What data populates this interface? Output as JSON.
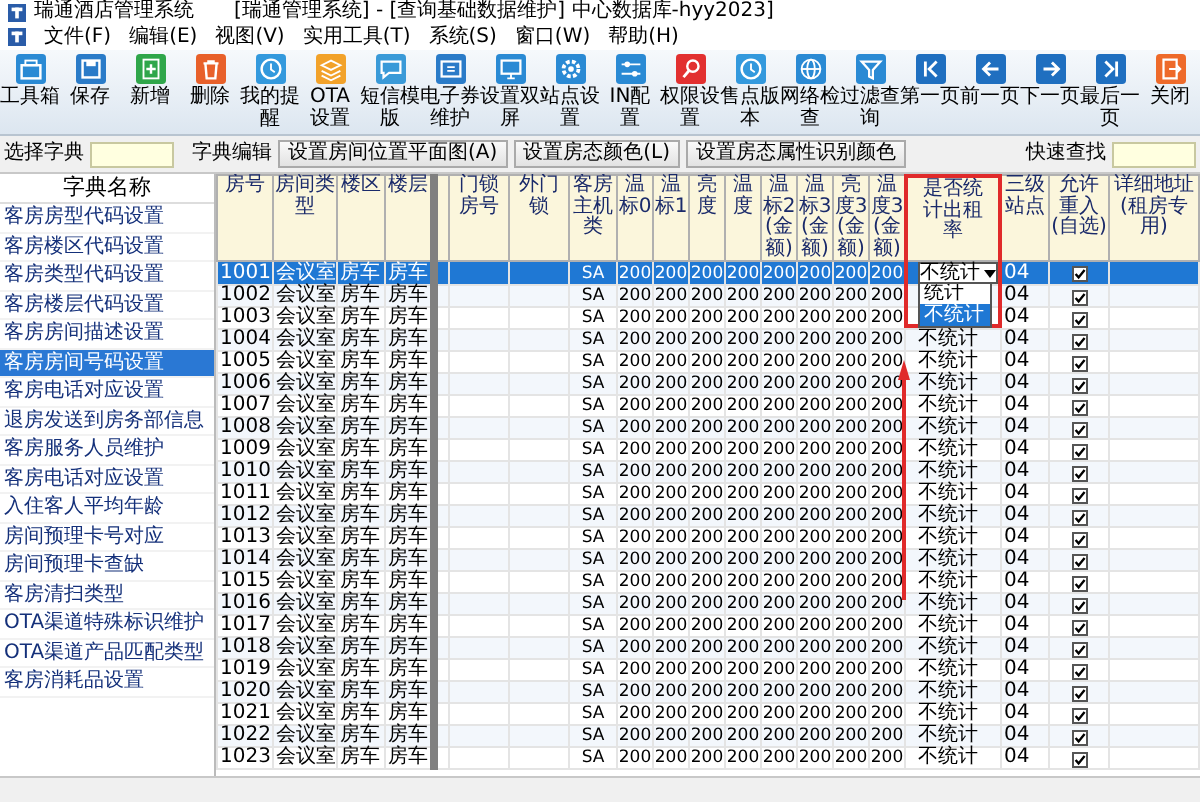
{
  "window": {
    "app_title": "瑞通酒店管理系统",
    "title": "[瑞通管理系统] - [查询基础数据维护] 中心数据库-hyy2023]"
  },
  "menu": [
    "文件(F)",
    "编辑(E)",
    "视图(V)",
    "实用工具(T)",
    "系统(S)",
    "窗口(W)",
    "帮助(H)"
  ],
  "toolbar": [
    "工具箱",
    "保存",
    "新增",
    "删除",
    "我的提醒",
    "OTA设置",
    "短信模版",
    "电子券维护",
    "设置双屏",
    "站点设置",
    "IN配置",
    "权限设置",
    "售点版本",
    "网络检查",
    "过滤查询",
    "第一页",
    "前一页",
    "下一页",
    "最后一页",
    "关闭"
  ],
  "filter_bar": {
    "dict_label": "选择字典",
    "edit_label": "字典编辑",
    "buttons": [
      "设置房间位置平面图(A)",
      "设置房态颜色(L)",
      "设置房态属性识别颜色"
    ],
    "search_label": "快速查找"
  },
  "sidebar": {
    "header": "字典名称",
    "items": [
      {
        "label": "客房房型代码设置",
        "selected": false
      },
      {
        "label": "客房楼区代码设置",
        "selected": false
      },
      {
        "label": "客房类型代码设置",
        "selected": false
      },
      {
        "label": "客房楼层代码设置",
        "selected": false
      },
      {
        "label": "客房房间描述设置",
        "selected": false
      },
      {
        "label": "客房房间号码设置",
        "selected": true
      },
      {
        "label": "客房电话对应设置",
        "selected": false
      },
      {
        "label": "退房发送到房务部信息",
        "selected": false
      },
      {
        "label": "客房服务人员维护",
        "selected": false
      },
      {
        "label": "客房电话对应设置",
        "selected": false
      },
      {
        "label": "入住客人平均年龄",
        "selected": false
      },
      {
        "label": "房间预理卡号对应",
        "selected": false
      },
      {
        "label": "房间预理卡查缺",
        "selected": false
      },
      {
        "label": "客房清扫类型",
        "selected": false
      },
      {
        "label": "OTA渠道特殊标识维护",
        "selected": false
      },
      {
        "label": "OTA渠道产品匹配类型",
        "selected": false
      },
      {
        "label": "客房消耗品设置",
        "selected": false
      }
    ]
  },
  "table": {
    "columns": [
      "房号",
      "房间类型",
      "楼区",
      "楼层",
      null,
      "门锁房号",
      "外门锁",
      "客房主机类",
      "温标0",
      "温标1",
      "亮度",
      "温度",
      "温标2(金额)",
      "温标3(金额)",
      "亮度3(金额)",
      "温度3(金额)",
      "是否统计出租率",
      "三级站点",
      "允许重入(自选)",
      "详细地址(租房专用)"
    ],
    "dropdown": {
      "value": "不统计",
      "options": [
        {
          "label": "统计",
          "selected": false
        },
        {
          "label": "不统计",
          "selected": true
        }
      ]
    },
    "rows": [
      {
        "selected": true,
        "checked": true,
        "cells": [
          "1001",
          "会议室",
          "房车",
          "房车",
          null,
          null,
          null,
          "SA",
          "200",
          "200",
          "200",
          "200",
          "200",
          "200",
          "200",
          "200",
          null,
          "04"
        ]
      },
      {
        "selected": false,
        "checked": true,
        "cells": [
          "1002",
          "会议室",
          "房车",
          "房车",
          null,
          null,
          null,
          "SA",
          "200",
          "200",
          "200",
          "200",
          "200",
          "200",
          "200",
          "200",
          null,
          "04"
        ]
      },
      {
        "selected": false,
        "checked": true,
        "cells": [
          "1003",
          "会议室",
          "房车",
          "房车",
          null,
          null,
          null,
          "SA",
          "200",
          "200",
          "200",
          "200",
          "200",
          "200",
          "200",
          "200",
          null,
          "04"
        ]
      },
      {
        "selected": false,
        "checked": true,
        "cells": [
          "1004",
          "会议室",
          "房车",
          "房车",
          null,
          null,
          null,
          "SA",
          "200",
          "200",
          "200",
          "200",
          "200",
          "200",
          "200",
          "200",
          "不统计",
          "04"
        ]
      },
      {
        "selected": false,
        "checked": true,
        "cells": [
          "1005",
          "会议室",
          "房车",
          "房车",
          null,
          null,
          null,
          "SA",
          "200",
          "200",
          "200",
          "200",
          "200",
          "200",
          "200",
          "200",
          "不统计",
          "04"
        ]
      },
      {
        "selected": false,
        "checked": true,
        "cells": [
          "1006",
          "会议室",
          "房车",
          "房车",
          null,
          null,
          null,
          "SA",
          "200",
          "200",
          "200",
          "200",
          "200",
          "200",
          "200",
          "200",
          "不统计",
          "04"
        ]
      },
      {
        "selected": false,
        "checked": true,
        "cells": [
          "1007",
          "会议室",
          "房车",
          "房车",
          null,
          null,
          null,
          "SA",
          "200",
          "200",
          "200",
          "200",
          "200",
          "200",
          "200",
          "200",
          "不统计",
          "04"
        ]
      },
      {
        "selected": false,
        "checked": true,
        "cells": [
          "1008",
          "会议室",
          "房车",
          "房车",
          null,
          null,
          null,
          "SA",
          "200",
          "200",
          "200",
          "200",
          "200",
          "200",
          "200",
          "200",
          "不统计",
          "04"
        ]
      },
      {
        "selected": false,
        "checked": true,
        "cells": [
          "1009",
          "会议室",
          "房车",
          "房车",
          null,
          null,
          null,
          "SA",
          "200",
          "200",
          "200",
          "200",
          "200",
          "200",
          "200",
          "200",
          "不统计",
          "04"
        ]
      },
      {
        "selected": false,
        "checked": true,
        "cells": [
          "1010",
          "会议室",
          "房车",
          "房车",
          null,
          null,
          null,
          "SA",
          "200",
          "200",
          "200",
          "200",
          "200",
          "200",
          "200",
          "200",
          "不统计",
          "04"
        ]
      },
      {
        "selected": false,
        "checked": true,
        "cells": [
          "1011",
          "会议室",
          "房车",
          "房车",
          null,
          null,
          null,
          "SA",
          "200",
          "200",
          "200",
          "200",
          "200",
          "200",
          "200",
          "200",
          "不统计",
          "04"
        ]
      },
      {
        "selected": false,
        "checked": true,
        "cells": [
          "1012",
          "会议室",
          "房车",
          "房车",
          null,
          null,
          null,
          "SA",
          "200",
          "200",
          "200",
          "200",
          "200",
          "200",
          "200",
          "200",
          "不统计",
          "04"
        ]
      },
      {
        "selected": false,
        "checked": true,
        "cells": [
          "1013",
          "会议室",
          "房车",
          "房车",
          null,
          null,
          null,
          "SA",
          "200",
          "200",
          "200",
          "200",
          "200",
          "200",
          "200",
          "200",
          "不统计",
          "04"
        ]
      },
      {
        "selected": false,
        "checked": true,
        "cells": [
          "1014",
          "会议室",
          "房车",
          "房车",
          null,
          null,
          null,
          "SA",
          "200",
          "200",
          "200",
          "200",
          "200",
          "200",
          "200",
          "200",
          "不统计",
          "04"
        ]
      },
      {
        "selected": false,
        "checked": true,
        "cells": [
          "1015",
          "会议室",
          "房车",
          "房车",
          null,
          null,
          null,
          "SA",
          "200",
          "200",
          "200",
          "200",
          "200",
          "200",
          "200",
          "200",
          "不统计",
          "04"
        ]
      },
      {
        "selected": false,
        "checked": true,
        "cells": [
          "1016",
          "会议室",
          "房车",
          "房车",
          null,
          null,
          null,
          "SA",
          "200",
          "200",
          "200",
          "200",
          "200",
          "200",
          "200",
          "200",
          "不统计",
          "04"
        ]
      },
      {
        "selected": false,
        "checked": true,
        "cells": [
          "1017",
          "会议室",
          "房车",
          "房车",
          null,
          null,
          null,
          "SA",
          "200",
          "200",
          "200",
          "200",
          "200",
          "200",
          "200",
          "200",
          "不统计",
          "04"
        ]
      },
      {
        "selected": false,
        "checked": true,
        "cells": [
          "1018",
          "会议室",
          "房车",
          "房车",
          null,
          null,
          null,
          "SA",
          "200",
          "200",
          "200",
          "200",
          "200",
          "200",
          "200",
          "200",
          "不统计",
          "04"
        ]
      },
      {
        "selected": false,
        "checked": true,
        "cells": [
          "1019",
          "会议室",
          "房车",
          "房车",
          null,
          null,
          null,
          "SA",
          "200",
          "200",
          "200",
          "200",
          "200",
          "200",
          "200",
          "200",
          "不统计",
          "04"
        ]
      },
      {
        "selected": false,
        "checked": true,
        "cells": [
          "1020",
          "会议室",
          "房车",
          "房车",
          null,
          null,
          null,
          "SA",
          "200",
          "200",
          "200",
          "200",
          "200",
          "200",
          "200",
          "200",
          "不统计",
          "04"
        ]
      },
      {
        "selected": false,
        "checked": true,
        "cells": [
          "1021",
          "会议室",
          "房车",
          "房车",
          null,
          null,
          null,
          "SA",
          "200",
          "200",
          "200",
          "200",
          "200",
          "200",
          "200",
          "200",
          "不统计",
          "04"
        ]
      },
      {
        "selected": false,
        "checked": true,
        "cells": [
          "1022",
          "会议室",
          "房车",
          "房车",
          null,
          null,
          null,
          "SA",
          "200",
          "200",
          "200",
          "200",
          "200",
          "200",
          "200",
          "200",
          "不统计",
          "04"
        ]
      },
      {
        "selected": false,
        "checked": true,
        "cells": [
          "1023",
          "会议室",
          "房车",
          "房车",
          null,
          null,
          null,
          "SA",
          "200",
          "200",
          "200",
          "200",
          "200",
          "200",
          "200",
          "200",
          "不统计",
          "04"
        ]
      }
    ]
  }
}
